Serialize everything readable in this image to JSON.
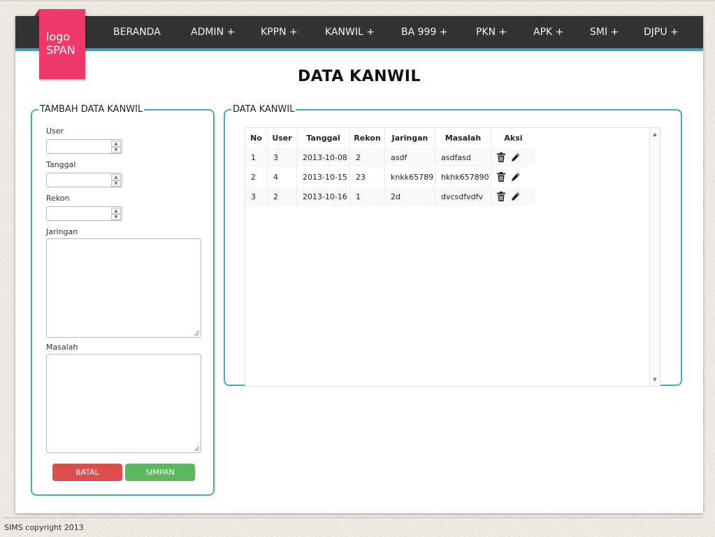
{
  "logo": {
    "line1": "logo",
    "line2": "SPAN"
  },
  "nav": {
    "items": [
      "BERANDA",
      "ADMIN +",
      "KPPN +",
      "KANWIL +",
      "BA 999 +",
      "PKN +",
      "APK +",
      "SMI +",
      "DJPU +"
    ]
  },
  "page_title": "DATA KANWIL",
  "form": {
    "legend": "TAMBAH DATA KANWIL",
    "user_label": "User",
    "user_value": "",
    "tanggal_label": "Tanggal",
    "tanggal_value": "",
    "rekon_label": "Rekon",
    "rekon_value": "",
    "jaringan_label": "Jaringan",
    "jaringan_value": "",
    "masalah_label": "Masalah",
    "masalah_value": "",
    "batal_label": "BATAL",
    "simpan_label": "SIMPAN"
  },
  "table": {
    "legend": "DATA KANWIL",
    "headers": [
      "No",
      "User",
      "Tanggal",
      "Rekon",
      "Jaringan",
      "Masalah",
      "Aksi"
    ],
    "rows": [
      [
        "1",
        "3",
        "2013-10-08",
        "2",
        "asdf",
        "asdfasd"
      ],
      [
        "2",
        "4",
        "2013-10-15",
        "23",
        "knkk65789",
        "hkhk657890"
      ],
      [
        "3",
        "2",
        "2013-10-16",
        "1",
        "2d",
        "dvcsdfvdfv"
      ]
    ]
  },
  "footer": "SIMS copyright 2013",
  "colors": {
    "navbar": "#333333",
    "accent": "#3ba3c0",
    "logo": "#f0396a",
    "batal": "#dc4f4c",
    "simpan": "#5cb85f"
  }
}
